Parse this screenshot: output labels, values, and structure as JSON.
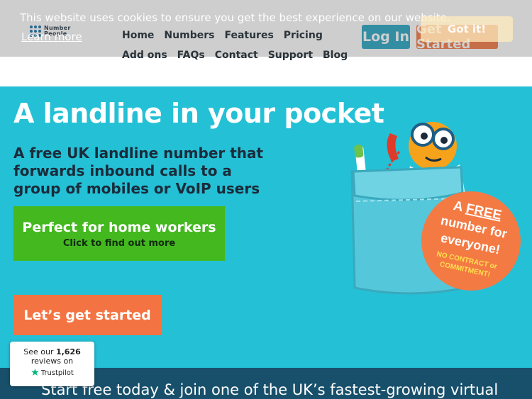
{
  "cookie": {
    "message": "This website uses cookies to ensure you get the best experience on our website.",
    "learn_more": "Learn more",
    "accept_label": "Got it!"
  },
  "logo": {
    "line1": "Number",
    "line2": "People"
  },
  "nav": {
    "items": [
      "Home",
      "Numbers",
      "Features",
      "Pricing",
      "Add ons",
      "FAQs",
      "Contact",
      "Support",
      "Blog"
    ]
  },
  "header": {
    "login_label": "Log In",
    "get_started_label": "Get Started"
  },
  "hero": {
    "title": "A landline in your pocket",
    "subtitle": "A free UK landline number that forwards inbound calls to a group of mobiles or VoIP users",
    "home_workers_title": "Perfect for home workers",
    "home_workers_sub": "Click to find out more",
    "start_label": "Let’s get started"
  },
  "badge": {
    "line1_a": "A ",
    "line1_b": "FREE",
    "line2": "number for",
    "line3": "everyone!",
    "line4": "NO CONTRACT or",
    "line5": "COMMITMENT!"
  },
  "band": {
    "text": "Start free today & join one of the UK’s fastest-growing virtual"
  },
  "trustpilot": {
    "prefix": "See our",
    "count": "1,626",
    "line2": "reviews on",
    "brand": "Trustpilot"
  },
  "colors": {
    "hero_bg": "#24c0d6",
    "green_button": "#43b91f",
    "orange_button": "#f37442",
    "login_button": "#2aa7c4",
    "band_bg": "#18506b",
    "badge_bg": "#f47a44"
  }
}
